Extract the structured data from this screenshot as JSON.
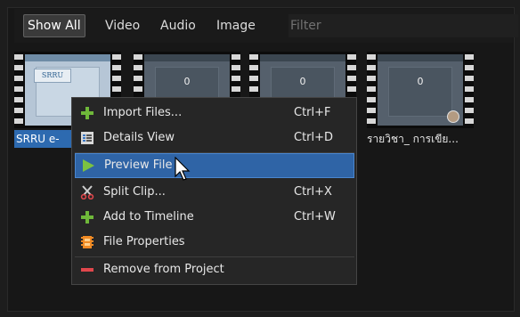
{
  "filter_bar": {
    "buttons": [
      "Show All",
      "Video",
      "Audio",
      "Image"
    ],
    "active": "Show All",
    "filter_placeholder": "Filter"
  },
  "files": [
    {
      "label": "SRRU e-",
      "thumb_text": "SRRU",
      "selected": true
    },
    {
      "label": "",
      "thumb_text": "0",
      "selected": false
    },
    {
      "label": "",
      "thumb_text": "0",
      "selected": false
    },
    {
      "label": "รายวิชา_ การเขีย...",
      "thumb_text": "0",
      "selected": false
    }
  ],
  "context_menu": {
    "items": [
      {
        "label": "Import Files...",
        "shortcut": "Ctrl+F",
        "icon": "plus-icon",
        "highlighted": false
      },
      {
        "label": "Details View",
        "shortcut": "Ctrl+D",
        "icon": "details-view-icon",
        "highlighted": false
      },
      {
        "label": "Preview File",
        "shortcut": "",
        "icon": "play-icon",
        "highlighted": true
      },
      {
        "label": "Split Clip...",
        "shortcut": "Ctrl+X",
        "icon": "scissors-icon",
        "highlighted": false
      },
      {
        "label": "Add to Timeline",
        "shortcut": "Ctrl+W",
        "icon": "plus-icon",
        "highlighted": false
      },
      {
        "label": "File Properties",
        "shortcut": "",
        "icon": "film-strip-icon",
        "highlighted": false
      },
      {
        "label": "Remove from Project",
        "shortcut": "",
        "icon": "minus-icon",
        "highlighted": false
      }
    ]
  },
  "colors": {
    "accent": "#2f64a6",
    "plus": "#6fb83a",
    "play": "#7cc241",
    "minus": "#e0474c",
    "film": "#f08a24"
  }
}
